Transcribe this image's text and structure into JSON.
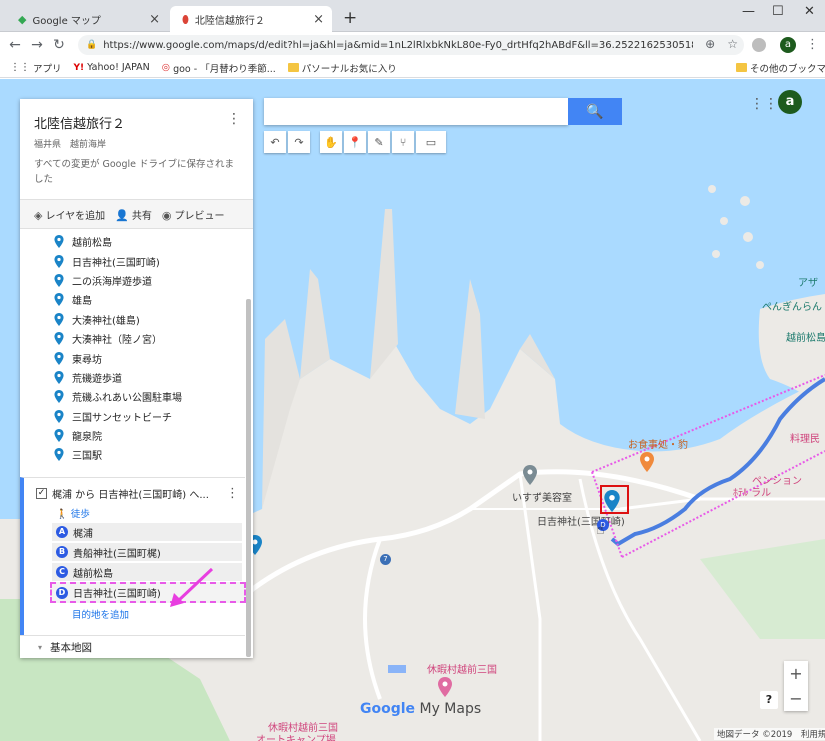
{
  "browser": {
    "tabs": [
      {
        "title": "Google マップ",
        "active": false
      },
      {
        "title": "北陸信越旅行２",
        "active": true
      }
    ],
    "url": "https://www.google.com/maps/d/edit?hl=ja&hl=ja&mid=1nL2lRlxbkNkL80e-Fy0_drtHfq2hABdF&ll=36.252216253051856%2C136.140998...",
    "bookmarks": [
      "アプリ",
      "Yahoo! JAPAN",
      "goo - 「月替わり季節...",
      "パソーナルお気に入り",
      "その他のブックマーク"
    ],
    "account_initial": "a"
  },
  "map": {
    "account_initial": "a",
    "logo_main": "Google",
    "logo_sub": " My Maps",
    "attribution": "地図データ ©2019　利用規約",
    "zoom_in": "+",
    "zoom_out": "−",
    "help": "?",
    "labels": {
      "osyokuji": "お食事処・豹",
      "isuzu": "いすず美容室",
      "hiyoshi": "日吉神社(三国町崎)",
      "pension": "ペンション",
      "lal": "ﾎﾃﾙ ラル",
      "ryori": "料理民",
      "penguin": "ぺんぎんらん",
      "echizen_matsushima": "越前松島",
      "aza": "アザ",
      "kyuka": "休暇村越前三国",
      "camp1": "休暇村越前三国",
      "camp2": "オートキャンプ場"
    }
  },
  "panel": {
    "title": "北陸信越旅行２",
    "subtitle": "福井県　越前海岸",
    "saved": "すべての変更が Google ドライブに保存されました",
    "actions": {
      "add_layer": "レイヤを追加",
      "share": "共有",
      "preview": "プレビュー"
    },
    "places": [
      "越前松島",
      "日吉神社(三国町崎)",
      "二の浜海岸遊歩道",
      "雄島",
      "大湊神社(雄島)",
      "大湊神社（陸ノ宮）",
      "東尋坊",
      "荒磯遊歩道",
      "荒磯ふれあい公園駐車場",
      "三国サンセットビーチ",
      "龍泉院",
      "三国駅"
    ],
    "route": {
      "title": "梶浦 から 日吉神社(三国町崎) へ...",
      "mode": "徒歩",
      "waypoints": [
        {
          "letter": "A",
          "name": "梶浦"
        },
        {
          "letter": "B",
          "name": "貴船神社(三国町梶)"
        },
        {
          "letter": "C",
          "name": "越前松島"
        },
        {
          "letter": "D",
          "name": "日吉神社(三国町崎)"
        }
      ],
      "add_destination": "目的地を追加"
    },
    "basemap": "基本地図"
  }
}
